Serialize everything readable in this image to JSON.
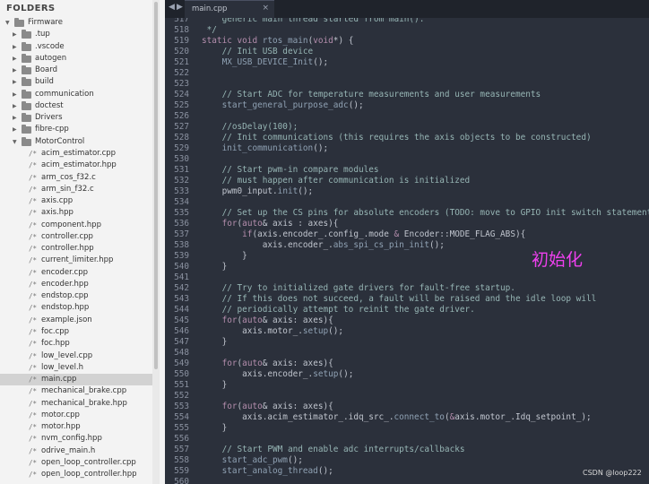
{
  "sidebar": {
    "header": "FOLDERS",
    "items": [
      {
        "label": "Firmware",
        "kind": "folder",
        "depth": 0,
        "open": true,
        "selected": false
      },
      {
        "label": ".tup",
        "kind": "folder",
        "depth": 1,
        "open": false,
        "selected": false
      },
      {
        "label": ".vscode",
        "kind": "folder",
        "depth": 1,
        "open": false,
        "selected": false
      },
      {
        "label": "autogen",
        "kind": "folder",
        "depth": 1,
        "open": false,
        "selected": false
      },
      {
        "label": "Board",
        "kind": "folder",
        "depth": 1,
        "open": false,
        "selected": false
      },
      {
        "label": "build",
        "kind": "folder",
        "depth": 1,
        "open": false,
        "selected": false
      },
      {
        "label": "communication",
        "kind": "folder",
        "depth": 1,
        "open": false,
        "selected": false
      },
      {
        "label": "doctest",
        "kind": "folder",
        "depth": 1,
        "open": false,
        "selected": false
      },
      {
        "label": "Drivers",
        "kind": "folder",
        "depth": 1,
        "open": false,
        "selected": false
      },
      {
        "label": "fibre-cpp",
        "kind": "folder",
        "depth": 1,
        "open": false,
        "selected": false
      },
      {
        "label": "MotorControl",
        "kind": "folder",
        "depth": 1,
        "open": true,
        "selected": false
      },
      {
        "label": "acim_estimator.cpp",
        "kind": "file",
        "depth": 2,
        "selected": false
      },
      {
        "label": "acim_estimator.hpp",
        "kind": "file",
        "depth": 2,
        "selected": false
      },
      {
        "label": "arm_cos_f32.c",
        "kind": "file",
        "depth": 2,
        "selected": false
      },
      {
        "label": "arm_sin_f32.c",
        "kind": "file",
        "depth": 2,
        "selected": false
      },
      {
        "label": "axis.cpp",
        "kind": "file",
        "depth": 2,
        "selected": false
      },
      {
        "label": "axis.hpp",
        "kind": "file",
        "depth": 2,
        "selected": false
      },
      {
        "label": "component.hpp",
        "kind": "file",
        "depth": 2,
        "selected": false
      },
      {
        "label": "controller.cpp",
        "kind": "file",
        "depth": 2,
        "selected": false
      },
      {
        "label": "controller.hpp",
        "kind": "file",
        "depth": 2,
        "selected": false
      },
      {
        "label": "current_limiter.hpp",
        "kind": "file",
        "depth": 2,
        "selected": false
      },
      {
        "label": "encoder.cpp",
        "kind": "file",
        "depth": 2,
        "selected": false
      },
      {
        "label": "encoder.hpp",
        "kind": "file",
        "depth": 2,
        "selected": false
      },
      {
        "label": "endstop.cpp",
        "kind": "file",
        "depth": 2,
        "selected": false
      },
      {
        "label": "endstop.hpp",
        "kind": "file",
        "depth": 2,
        "selected": false
      },
      {
        "label": "example.json",
        "kind": "file",
        "depth": 2,
        "selected": false
      },
      {
        "label": "foc.cpp",
        "kind": "file",
        "depth": 2,
        "selected": false
      },
      {
        "label": "foc.hpp",
        "kind": "file",
        "depth": 2,
        "selected": false
      },
      {
        "label": "low_level.cpp",
        "kind": "file",
        "depth": 2,
        "selected": false
      },
      {
        "label": "low_level.h",
        "kind": "file",
        "depth": 2,
        "selected": false
      },
      {
        "label": "main.cpp",
        "kind": "file",
        "depth": 2,
        "selected": true
      },
      {
        "label": "mechanical_brake.cpp",
        "kind": "file",
        "depth": 2,
        "selected": false
      },
      {
        "label": "mechanical_brake.hpp",
        "kind": "file",
        "depth": 2,
        "selected": false
      },
      {
        "label": "motor.cpp",
        "kind": "file",
        "depth": 2,
        "selected": false
      },
      {
        "label": "motor.hpp",
        "kind": "file",
        "depth": 2,
        "selected": false
      },
      {
        "label": "nvm_config.hpp",
        "kind": "file",
        "depth": 2,
        "selected": false
      },
      {
        "label": "odrive_main.h",
        "kind": "file",
        "depth": 2,
        "selected": false
      },
      {
        "label": "open_loop_controller.cpp",
        "kind": "file",
        "depth": 2,
        "selected": false
      },
      {
        "label": "open_loop_controller.hpp",
        "kind": "file",
        "depth": 2,
        "selected": false
      }
    ]
  },
  "tabbar": {
    "nav_left": "◀",
    "nav_right": "▶",
    "tab_label": "main.cpp",
    "close_glyph": "×"
  },
  "editor": {
    "lines": [
      {
        "n": "517",
        "tokens": [
          {
            "t": "    generic main thread started from main().",
            "c": "cm"
          }
        ]
      },
      {
        "n": "518",
        "tokens": [
          {
            "t": " */",
            "c": "cm"
          }
        ]
      },
      {
        "n": "519",
        "tokens": [
          {
            "t": "static ",
            "c": "kw"
          },
          {
            "t": "void ",
            "c": "kw"
          },
          {
            "t": "rtos_main",
            "c": "fn"
          },
          {
            "t": "(",
            "c": "op"
          },
          {
            "t": "void",
            "c": "kw"
          },
          {
            "t": "*) {",
            "c": "op"
          }
        ]
      },
      {
        "n": "520",
        "tokens": [
          {
            "t": "    // Init USB device",
            "c": "cm"
          }
        ]
      },
      {
        "n": "521",
        "tokens": [
          {
            "t": "    ",
            "c": "op"
          },
          {
            "t": "MX_USB_DEVICE_Init",
            "c": "fn"
          },
          {
            "t": "();",
            "c": "op"
          }
        ]
      },
      {
        "n": "522",
        "tokens": []
      },
      {
        "n": "523",
        "tokens": []
      },
      {
        "n": "524",
        "tokens": [
          {
            "t": "    // Start ADC for temperature measurements and user measurements",
            "c": "cm"
          }
        ]
      },
      {
        "n": "525",
        "tokens": [
          {
            "t": "    ",
            "c": "op"
          },
          {
            "t": "start_general_purpose_adc",
            "c": "fn"
          },
          {
            "t": "();",
            "c": "op"
          }
        ]
      },
      {
        "n": "526",
        "tokens": []
      },
      {
        "n": "527",
        "tokens": [
          {
            "t": "    //osDelay(100);",
            "c": "cm"
          }
        ]
      },
      {
        "n": "528",
        "tokens": [
          {
            "t": "    // Init communications (this requires the axis objects to be constructed)",
            "c": "cm"
          }
        ]
      },
      {
        "n": "529",
        "tokens": [
          {
            "t": "    ",
            "c": "op"
          },
          {
            "t": "init_communication",
            "c": "fn"
          },
          {
            "t": "();",
            "c": "op"
          }
        ]
      },
      {
        "n": "530",
        "tokens": []
      },
      {
        "n": "531",
        "tokens": [
          {
            "t": "    // Start pwm-in compare modules",
            "c": "cm"
          }
        ]
      },
      {
        "n": "532",
        "tokens": [
          {
            "t": "    // must happen after communication is initialized",
            "c": "cm"
          }
        ]
      },
      {
        "n": "533",
        "tokens": [
          {
            "t": "    pwm0_input.",
            "c": "op"
          },
          {
            "t": "init",
            "c": "fn"
          },
          {
            "t": "();",
            "c": "op"
          }
        ]
      },
      {
        "n": "534",
        "tokens": []
      },
      {
        "n": "535",
        "tokens": [
          {
            "t": "    // Set up the CS pins for absolute encoders (TODO: move to GPIO init switch statement)",
            "c": "cm"
          }
        ]
      },
      {
        "n": "536",
        "tokens": [
          {
            "t": "    ",
            "c": "op"
          },
          {
            "t": "for",
            "c": "kw"
          },
          {
            "t": "(",
            "c": "op"
          },
          {
            "t": "auto",
            "c": "kw"
          },
          {
            "t": "& axis : axes){",
            "c": "op"
          }
        ]
      },
      {
        "n": "537",
        "tokens": [
          {
            "t": "        ",
            "c": "op"
          },
          {
            "t": "if",
            "c": "kw"
          },
          {
            "t": "(axis.encoder_.config_.mode ",
            "c": "op"
          },
          {
            "t": "&",
            "c": "kw"
          },
          {
            "t": " Encoder::MODE_FLAG_ABS){",
            "c": "op"
          }
        ]
      },
      {
        "n": "538",
        "tokens": [
          {
            "t": "            axis.encoder_.",
            "c": "op"
          },
          {
            "t": "abs_spi_cs_pin_init",
            "c": "fn"
          },
          {
            "t": "();",
            "c": "op"
          }
        ]
      },
      {
        "n": "539",
        "tokens": [
          {
            "t": "        }",
            "c": "op"
          }
        ]
      },
      {
        "n": "540",
        "tokens": [
          {
            "t": "    }",
            "c": "op"
          }
        ]
      },
      {
        "n": "541",
        "tokens": []
      },
      {
        "n": "542",
        "tokens": [
          {
            "t": "    // Try to initialized gate drivers for fault-free startup.",
            "c": "cm"
          }
        ]
      },
      {
        "n": "543",
        "tokens": [
          {
            "t": "    // If this does not succeed, a fault will be raised and the idle loop will",
            "c": "cm"
          }
        ]
      },
      {
        "n": "544",
        "tokens": [
          {
            "t": "    // periodically attempt to reinit the gate driver.",
            "c": "cm"
          }
        ]
      },
      {
        "n": "545",
        "tokens": [
          {
            "t": "    ",
            "c": "op"
          },
          {
            "t": "for",
            "c": "kw"
          },
          {
            "t": "(",
            "c": "op"
          },
          {
            "t": "auto",
            "c": "kw"
          },
          {
            "t": "& axis: axes){",
            "c": "op"
          }
        ]
      },
      {
        "n": "546",
        "tokens": [
          {
            "t": "        axis.motor_.",
            "c": "op"
          },
          {
            "t": "setup",
            "c": "fn"
          },
          {
            "t": "();",
            "c": "op"
          }
        ]
      },
      {
        "n": "547",
        "tokens": [
          {
            "t": "    }",
            "c": "op"
          }
        ]
      },
      {
        "n": "548",
        "tokens": []
      },
      {
        "n": "549",
        "tokens": [
          {
            "t": "    ",
            "c": "op"
          },
          {
            "t": "for",
            "c": "kw"
          },
          {
            "t": "(",
            "c": "op"
          },
          {
            "t": "auto",
            "c": "kw"
          },
          {
            "t": "& axis: axes){",
            "c": "op"
          }
        ]
      },
      {
        "n": "550",
        "tokens": [
          {
            "t": "        axis.encoder_.",
            "c": "op"
          },
          {
            "t": "setup",
            "c": "fn"
          },
          {
            "t": "();",
            "c": "op"
          }
        ]
      },
      {
        "n": "551",
        "tokens": [
          {
            "t": "    }",
            "c": "op"
          }
        ]
      },
      {
        "n": "552",
        "tokens": []
      },
      {
        "n": "553",
        "tokens": [
          {
            "t": "    ",
            "c": "op"
          },
          {
            "t": "for",
            "c": "kw"
          },
          {
            "t": "(",
            "c": "op"
          },
          {
            "t": "auto",
            "c": "kw"
          },
          {
            "t": "& axis: axes){",
            "c": "op"
          }
        ]
      },
      {
        "n": "554",
        "tokens": [
          {
            "t": "        axis.acim_estimator_.idq_src_.",
            "c": "op"
          },
          {
            "t": "connect_to",
            "c": "fn"
          },
          {
            "t": "(",
            "c": "op"
          },
          {
            "t": "&",
            "c": "kw"
          },
          {
            "t": "axis.motor_.Idq_setpoint_);",
            "c": "op"
          }
        ]
      },
      {
        "n": "555",
        "tokens": [
          {
            "t": "    }",
            "c": "op"
          }
        ]
      },
      {
        "n": "556",
        "tokens": []
      },
      {
        "n": "557",
        "tokens": [
          {
            "t": "    // Start PWM and enable adc interrupts/callbacks",
            "c": "cm"
          }
        ]
      },
      {
        "n": "558",
        "tokens": [
          {
            "t": "    ",
            "c": "op"
          },
          {
            "t": "start_adc_pwm",
            "c": "fn"
          },
          {
            "t": "();",
            "c": "op"
          }
        ]
      },
      {
        "n": "559",
        "tokens": [
          {
            "t": "    ",
            "c": "op"
          },
          {
            "t": "start_analog_thread",
            "c": "fn"
          },
          {
            "t": "();",
            "c": "op"
          }
        ]
      },
      {
        "n": "560",
        "tokens": []
      }
    ]
  },
  "annotation": "初始化",
  "watermark": "CSDN @loop222",
  "colors": {
    "editor_bg": "#2b303b",
    "keyword": "#b48ead",
    "function": "#8fa1b3",
    "comment": "#96b5b4",
    "annotation": "#ee40ee"
  }
}
